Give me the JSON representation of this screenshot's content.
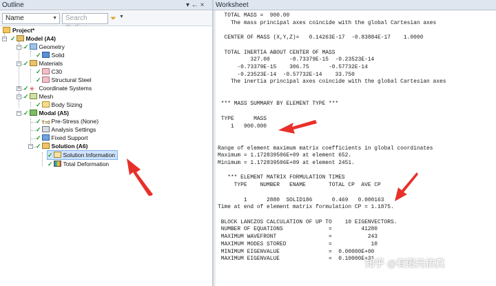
{
  "outline": {
    "title": "Outline",
    "pin_glyph": "▾ ← ×",
    "name_label": "Name",
    "search_placeholder": "Search Outline"
  },
  "tree": {
    "project": "Project*",
    "model": "Model (A4)",
    "geometry": "Geometry",
    "solid": "Solid",
    "materials": "Materials",
    "c30": "C30",
    "structural_steel": "Structural Steel",
    "coordinate_systems": "Coordinate Systems",
    "mesh": "Mesh",
    "body_sizing": "Body Sizing",
    "modal": "Modal (A5)",
    "pre_stress": "Pre-Stress (None)",
    "analysis_settings": "Analysis Settings",
    "fixed_support": "Fixed Support",
    "solution": "Solution (A6)",
    "solution_information": "Solution Information",
    "total_deformation": "Total Deformation"
  },
  "worksheet": {
    "title": "Worksheet",
    "lines": [
      "  TOTAL MASS =  900.00",
      "    The mass principal axes coincide with the global Cartesian axes",
      "",
      "  CENTER OF MASS (X,Y,Z)=   0.14263E-17  -0.83884E-17    1.0000",
      "",
      "  TOTAL INERTIA ABOUT CENTER OF MASS",
      "          327.00      -0.73379E-15  -0.23523E-14",
      "      -0.73379E-15    306.75      -0.57732E-14",
      "      -0.23523E-14  -0.57732E-14    33.750",
      "    The inertia principal axes coincide with the global Cartesian axes",
      "",
      "",
      " *** MASS SUMMARY BY ELEMENT TYPE ***",
      "",
      " TYPE      MASS",
      "    1   900.000",
      "",
      "",
      "Range of element maximum matrix coefficients in global coordinates",
      "Maximum = 1.172839506E+09 at element 652.",
      "Minimum = 1.172839506E+09 at element 2451.",
      "",
      "   *** ELEMENT MATRIX FORMULATION TIMES",
      "     TYPE    NUMBER   ENAME       TOTAL CP  AVE CP",
      "",
      "        1      2880  SOLID186      0.469   0.000163",
      "Time at end of element matrix formulation CP = 1.1875.",
      "",
      " BLOCK LANCZOS CALCULATION OF UP TO    10 EIGENVECTORS.",
      " NUMBER OF EQUATIONS              =         41280",
      " MAXIMUM WAVEFRONT                =           243",
      " MAXIMUM MODES STORED             =            10",
      " MINIMUM EIGENVALUE               =  0.00000E+00",
      " MAXIMUM EIGENVALUE               =  0.10000E+31"
    ]
  },
  "watermark": "知乎 @有限元仿真",
  "colors": {
    "accent_arrow": "#e8302a",
    "check": "#1a9b2a",
    "header_bg": "#dfe6ef"
  }
}
